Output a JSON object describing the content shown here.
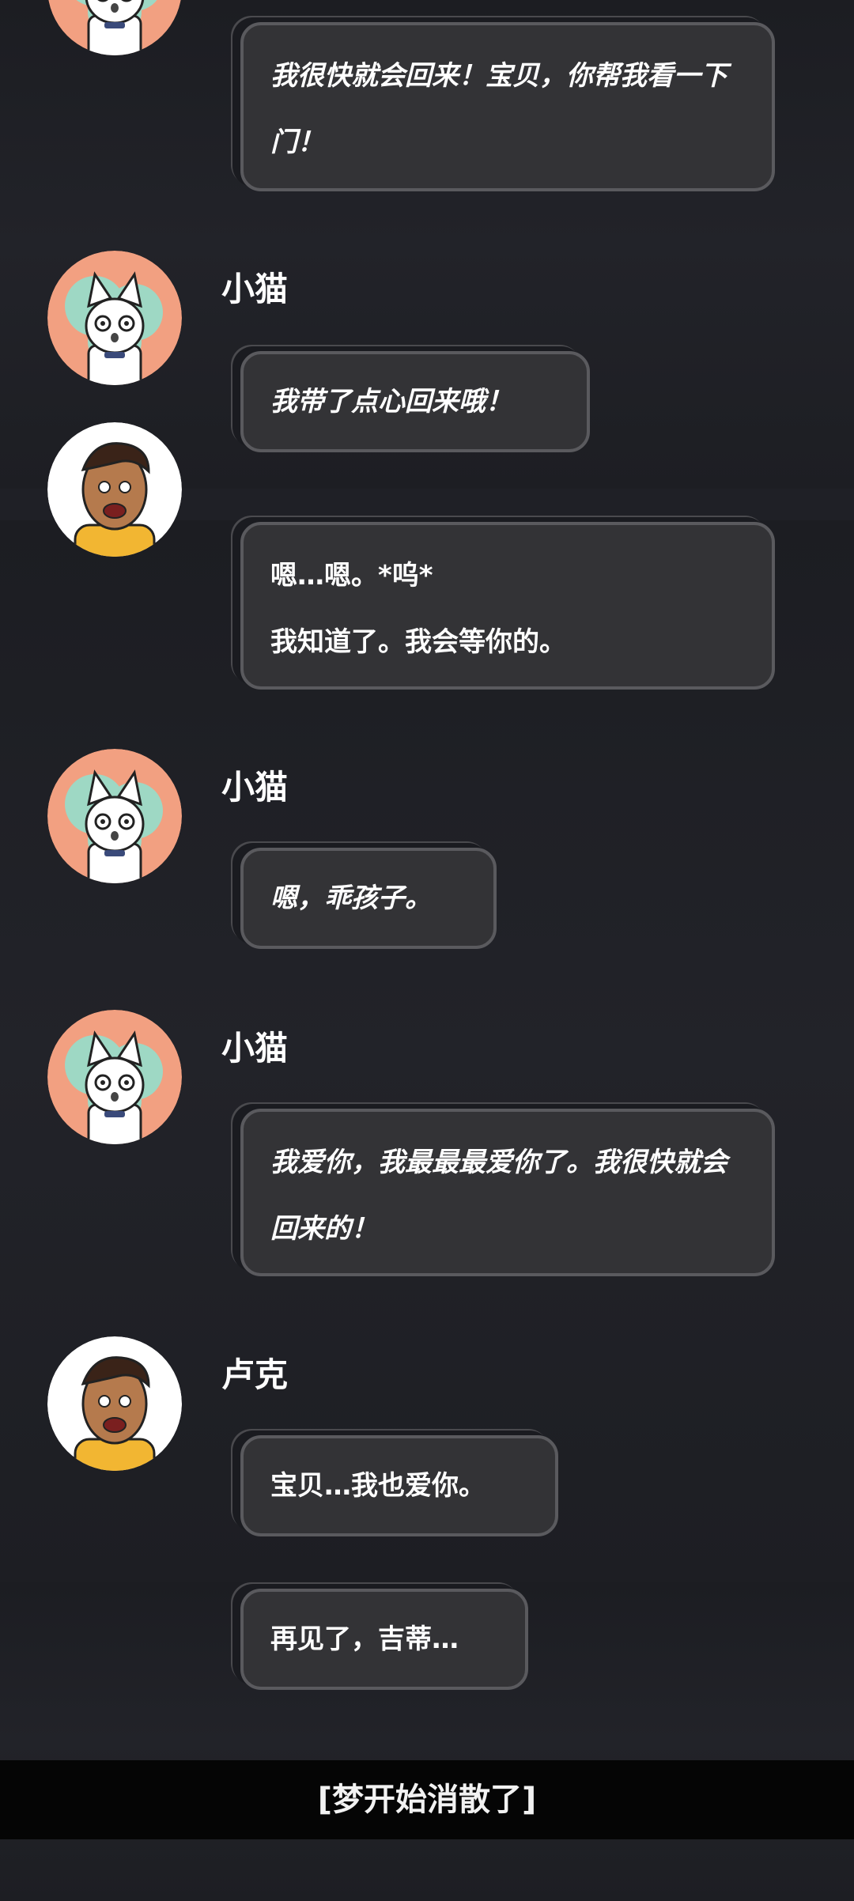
{
  "messages": [
    {
      "speaker": "",
      "text": "我很快就会回来！宝贝，你帮我看一下门！"
    },
    {
      "speaker": "小猫",
      "text": "我带了点心回来哦！"
    },
    {
      "speaker": "",
      "text_line1": "嗯…嗯。*呜*",
      "text_line2": "我知道了。我会等你的。"
    },
    {
      "speaker": "小猫",
      "text": "嗯，乖孩子。"
    },
    {
      "speaker": "小猫",
      "text": "我爱你，我最最最爱你了。我很快就会回来的！"
    },
    {
      "speaker": "卢克",
      "text": "宝贝…我也爱你。"
    },
    {
      "speaker": "",
      "text": "再见了，吉蒂…"
    }
  ],
  "footer": {
    "text": "[梦开始消散了]"
  },
  "colors": {
    "background": "#1f2026",
    "bubble": "#333336",
    "bubble_border": "#5a5a5e",
    "cat_avatar_bg": "#f2a081",
    "luke_avatar_bg": "#ffffff",
    "footer_bg": "#050505"
  },
  "icons": {
    "cat_avatar": "cat-character-avatar",
    "luke_avatar": "luke-character-avatar"
  }
}
